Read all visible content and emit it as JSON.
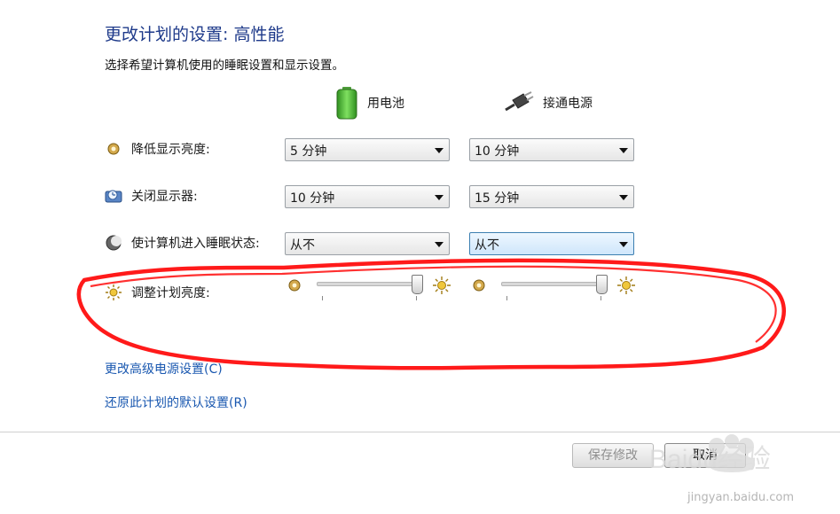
{
  "header": {
    "title": "更改计划的设置: 高性能",
    "subtitle": "选择希望计算机使用的睡眠设置和显示设置。"
  },
  "columns": {
    "battery_label": "用电池",
    "plugged_label": "接通电源"
  },
  "rows": {
    "dim_display": {
      "label": "降低显示亮度:",
      "battery": "5 分钟",
      "plugged": "10 分钟"
    },
    "turn_off_display": {
      "label": "关闭显示器:",
      "battery": "10 分钟",
      "plugged": "15 分钟"
    },
    "sleep": {
      "label": "使计算机进入睡眠状态:",
      "battery": "从不",
      "plugged": "从不"
    },
    "brightness": {
      "label": "调整计划亮度:",
      "battery_level": 1.0,
      "plugged_level": 1.0
    }
  },
  "links": {
    "advanced": "更改高级电源设置(C)",
    "restore": "还原此计划的默认设置(R)"
  },
  "buttons": {
    "save": "保存修改",
    "cancel": "取消"
  },
  "watermark": {
    "brand": "Baidu经验",
    "url": "jingyan.baidu.com"
  },
  "colors": {
    "title": "#1e3a8a",
    "link": "#1a58b0",
    "annotation": "#ff1a1a"
  }
}
